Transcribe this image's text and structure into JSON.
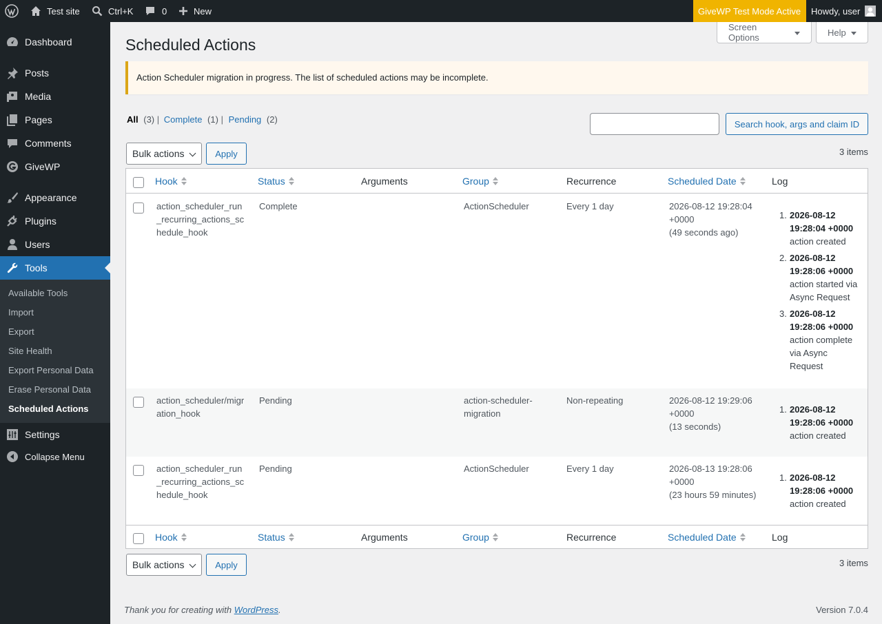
{
  "admin_bar": {
    "site_name": "Test site",
    "search_shortcut": "Ctrl+K",
    "comments_count": "0",
    "new_label": "New",
    "test_mode": "GiveWP Test Mode Active",
    "greeting": "Howdy, user"
  },
  "sidebar": {
    "items": [
      {
        "label": "Dashboard",
        "icon": "dashboard-icon"
      },
      {
        "label": "Posts",
        "icon": "pin-icon"
      },
      {
        "label": "Media",
        "icon": "media-icon"
      },
      {
        "label": "Pages",
        "icon": "pages-icon"
      },
      {
        "label": "Comments",
        "icon": "comment-icon"
      },
      {
        "label": "GiveWP",
        "icon": "givewp-icon"
      },
      {
        "label": "Appearance",
        "icon": "brush-icon"
      },
      {
        "label": "Plugins",
        "icon": "plug-icon"
      },
      {
        "label": "Users",
        "icon": "user-icon"
      },
      {
        "label": "Tools",
        "icon": "wrench-icon"
      },
      {
        "label": "Settings",
        "icon": "sliders-icon"
      }
    ],
    "submenu": [
      "Available Tools",
      "Import",
      "Export",
      "Site Health",
      "Export Personal Data",
      "Erase Personal Data",
      "Scheduled Actions"
    ],
    "collapse_label": "Collapse Menu"
  },
  "screen_options_label": "Screen Options",
  "help_label": "Help",
  "page_title": "Scheduled Actions",
  "notice": "Action Scheduler migration in progress. The list of scheduled actions may be incomplete.",
  "views": {
    "all_label": "All",
    "all_count": "(3)",
    "complete_label": "Complete",
    "complete_count": "(1)",
    "pending_label": "Pending",
    "pending_count": "(2)"
  },
  "search": {
    "value": "",
    "button": "Search hook, args and claim ID"
  },
  "bulk_actions_label": "Bulk actions",
  "apply_label": "Apply",
  "items_count": "3 items",
  "columns": {
    "hook": "Hook",
    "status": "Status",
    "arguments": "Arguments",
    "group": "Group",
    "recurrence": "Recurrence",
    "scheduled_date": "Scheduled Date",
    "log": "Log"
  },
  "rows": [
    {
      "hook": [
        "action_scheduler_run",
        "_recurring_actions_sc",
        "hedule_hook"
      ],
      "status": "Complete",
      "group": [
        "ActionScheduler"
      ],
      "recurrence": "Every 1 day",
      "scheduled": [
        "2026-08-12 19:28:04",
        "+0000",
        "(49 seconds ago)"
      ],
      "log": [
        {
          "date": [
            "2026-08-12",
            "19:28:04 +0000"
          ],
          "text": [
            "action created"
          ]
        },
        {
          "date": [
            "2026-08-12",
            "19:28:06 +0000"
          ],
          "text": [
            "action started via",
            "Async Request"
          ]
        },
        {
          "date": [
            "2026-08-12",
            "19:28:06 +0000"
          ],
          "text": [
            "action complete",
            "via Async",
            "Request"
          ]
        }
      ]
    },
    {
      "hook": [
        "action_scheduler/migr",
        "ation_hook"
      ],
      "status": "Pending",
      "group": [
        "action-scheduler-",
        "migration"
      ],
      "recurrence": "Non-repeating",
      "scheduled": [
        "2026-08-12 19:29:06",
        "+0000",
        "(13 seconds)"
      ],
      "log": [
        {
          "date": [
            "2026-08-12",
            "19:28:06 +0000"
          ],
          "text": [
            "action created"
          ]
        }
      ]
    },
    {
      "hook": [
        "action_scheduler_run",
        "_recurring_actions_sc",
        "hedule_hook"
      ],
      "status": "Pending",
      "group": [
        "ActionScheduler"
      ],
      "recurrence": "Every 1 day",
      "scheduled": [
        "2026-08-13 19:28:06",
        "+0000",
        "(23 hours 59 minutes)"
      ],
      "log": [
        {
          "date": [
            "2026-08-12",
            "19:28:06 +0000"
          ],
          "text": [
            "action created"
          ]
        }
      ]
    }
  ],
  "footer": {
    "thanks_prefix": "Thank you for creating with ",
    "link": "WordPress",
    "suffix": ".",
    "version": "Version 7.0.4"
  }
}
